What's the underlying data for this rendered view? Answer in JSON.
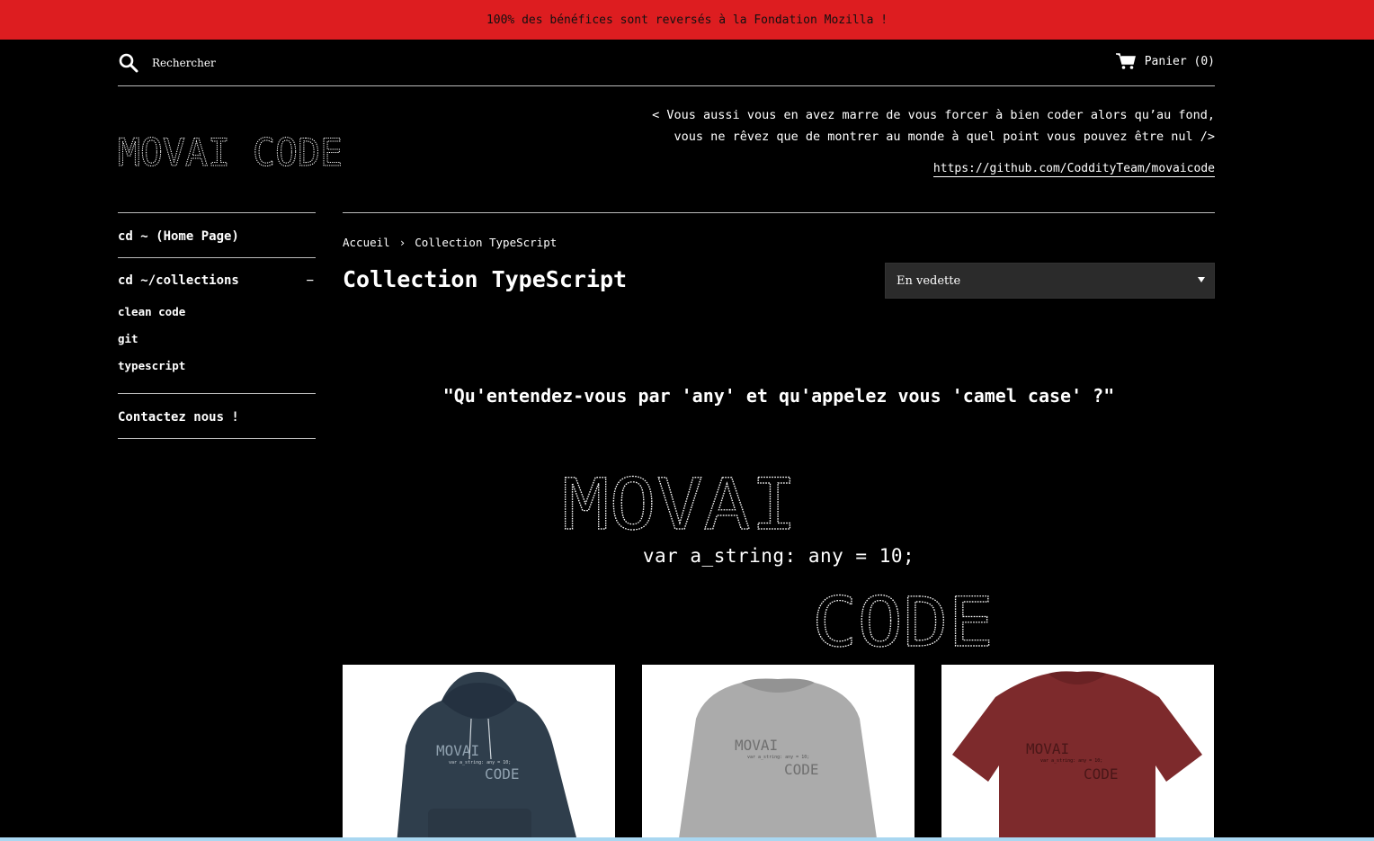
{
  "announcement": {
    "text": "100% des bénéfices sont reversés à la Fondation Mozilla !"
  },
  "header": {
    "search": {
      "placeholder": "Rechercher",
      "icon": "search-icon"
    },
    "cart": {
      "label": "Panier (0)",
      "icon": "cart-icon"
    },
    "logo_text": "MOVAI CODE",
    "tagline_line1": "< Vous aussi vous en avez marre de vous forcer à bien coder alors qu’au fond,",
    "tagline_line2": "vous ne rêvez que de montrer au monde à quel point vous pouvez être nul />",
    "github_link": "https://github.com/CoddityTeam/movaicode"
  },
  "sidebar": {
    "home": "cd ~ (Home Page)",
    "collections": {
      "label": "cd ~/collections",
      "toggle": "−",
      "items": [
        "clean code",
        "git",
        "typescript"
      ]
    },
    "contact": "Contactez nous !"
  },
  "breadcrumb": {
    "home": "Accueil",
    "separator": "›",
    "current": "Collection TypeScript"
  },
  "collection": {
    "title": "Collection TypeScript",
    "sort": {
      "selected": "En vedette"
    },
    "quote": "\"Qu'entendez-vous par 'any' et qu'appelez vous 'camel case' ?\"",
    "banner": {
      "top": "MOVAI",
      "code_line": "var a_string: any = 10;",
      "bottom": "CODE"
    }
  },
  "products": [
    {
      "name": "hoodie",
      "color": "#2f3e4c",
      "print_top": "MOVAI",
      "print_code": "var a_string: any = 10;",
      "print_bottom": "CODE"
    },
    {
      "name": "sweatshirt",
      "color": "#a9a9a9",
      "print_top": "MOVAI",
      "print_code": "var a_string: any = 10;",
      "print_bottom": "CODE"
    },
    {
      "name": "t-shirt",
      "color": "#7d2a2c",
      "print_top": "MOVAI",
      "print_code": "var a_string: any = 10;",
      "print_bottom": "CODE"
    }
  ],
  "colors": {
    "announcement_bg": "#dd1d20",
    "page_bg": "#000000",
    "text": "#ffffff"
  }
}
